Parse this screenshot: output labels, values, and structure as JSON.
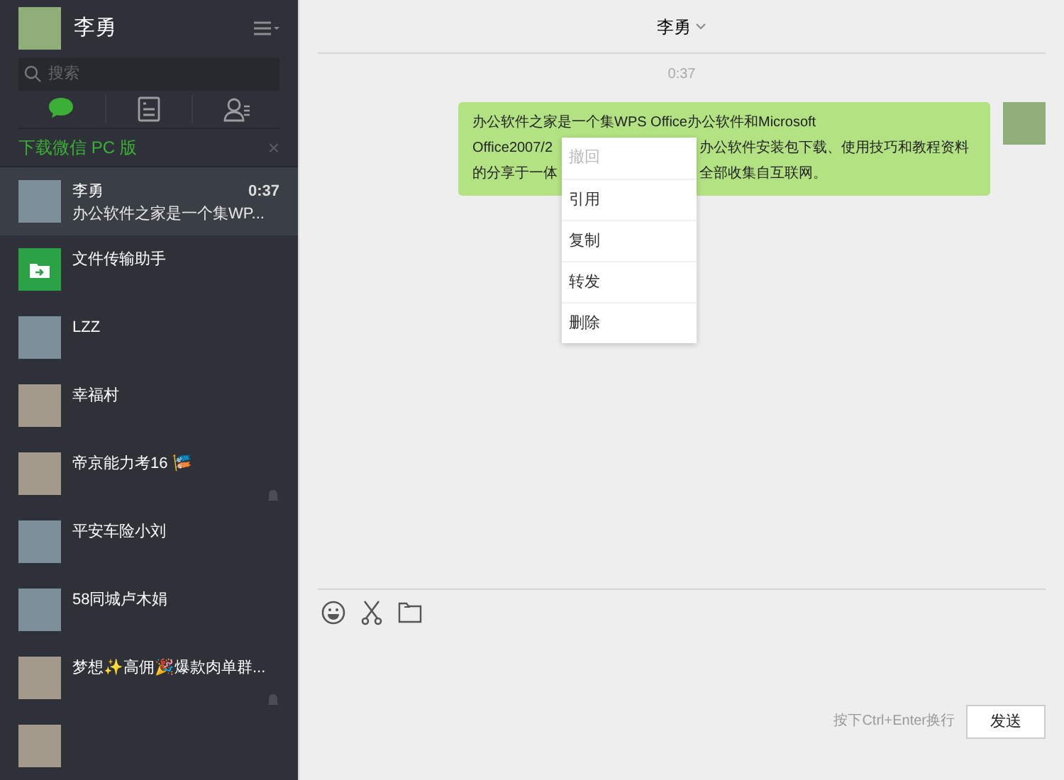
{
  "profile": {
    "name": "李勇"
  },
  "search": {
    "placeholder": "搜索"
  },
  "nav_tabs": [
    {
      "kind": "chat",
      "selected": true
    },
    {
      "kind": "contacts-card",
      "selected": false
    },
    {
      "kind": "people",
      "selected": false
    }
  ],
  "banner": {
    "text": "下载微信 PC 版",
    "close": "×"
  },
  "chats": [
    {
      "name": "李勇",
      "time": "0:37",
      "preview": "办公软件之家是一个集WP...",
      "kind": "photo",
      "muted": false,
      "selected": true
    },
    {
      "name": "文件传输助手",
      "kind": "file",
      "muted": false,
      "selected": false
    },
    {
      "name": "LZZ",
      "kind": "photo",
      "muted": false,
      "selected": false
    },
    {
      "name": "幸福村",
      "kind": "grid",
      "muted": false,
      "selected": false
    },
    {
      "name": "帝京能力考16 🎏",
      "kind": "grid",
      "muted": true,
      "selected": false
    },
    {
      "name": "平安车险小刘",
      "kind": "photo",
      "muted": false,
      "selected": false
    },
    {
      "name": "58同城卢木娟",
      "kind": "photo",
      "muted": false,
      "selected": false
    },
    {
      "name": "梦想✨高佣🎉爆款肉单群...",
      "kind": "grid",
      "muted": true,
      "selected": false
    },
    {
      "kind": "grid",
      "muted": false,
      "selected": false
    }
  ],
  "chat": {
    "title": "李勇",
    "time": "0:37",
    "message": {
      "lines": [
        [
          "办公软件之家是一个集WPS Office办公软件和Microsoft"
        ],
        [
          "Office2007/2",
          "办公软件安装包下载、使用技巧和教程资料"
        ],
        [
          "的分享于一体",
          "全部收集自互联网。"
        ]
      ]
    },
    "context_menu": [
      {
        "label": "撤回",
        "disabled": true
      },
      {
        "label": "引用",
        "disabled": false
      },
      {
        "label": "复制",
        "disabled": false
      },
      {
        "label": "转发",
        "disabled": false
      },
      {
        "label": "删除",
        "disabled": false
      }
    ],
    "toolbar": [
      {
        "kind": "emoji"
      },
      {
        "kind": "scissors"
      },
      {
        "kind": "folder"
      }
    ],
    "hint": "按下Ctrl+Enter换行",
    "send": "发送"
  }
}
